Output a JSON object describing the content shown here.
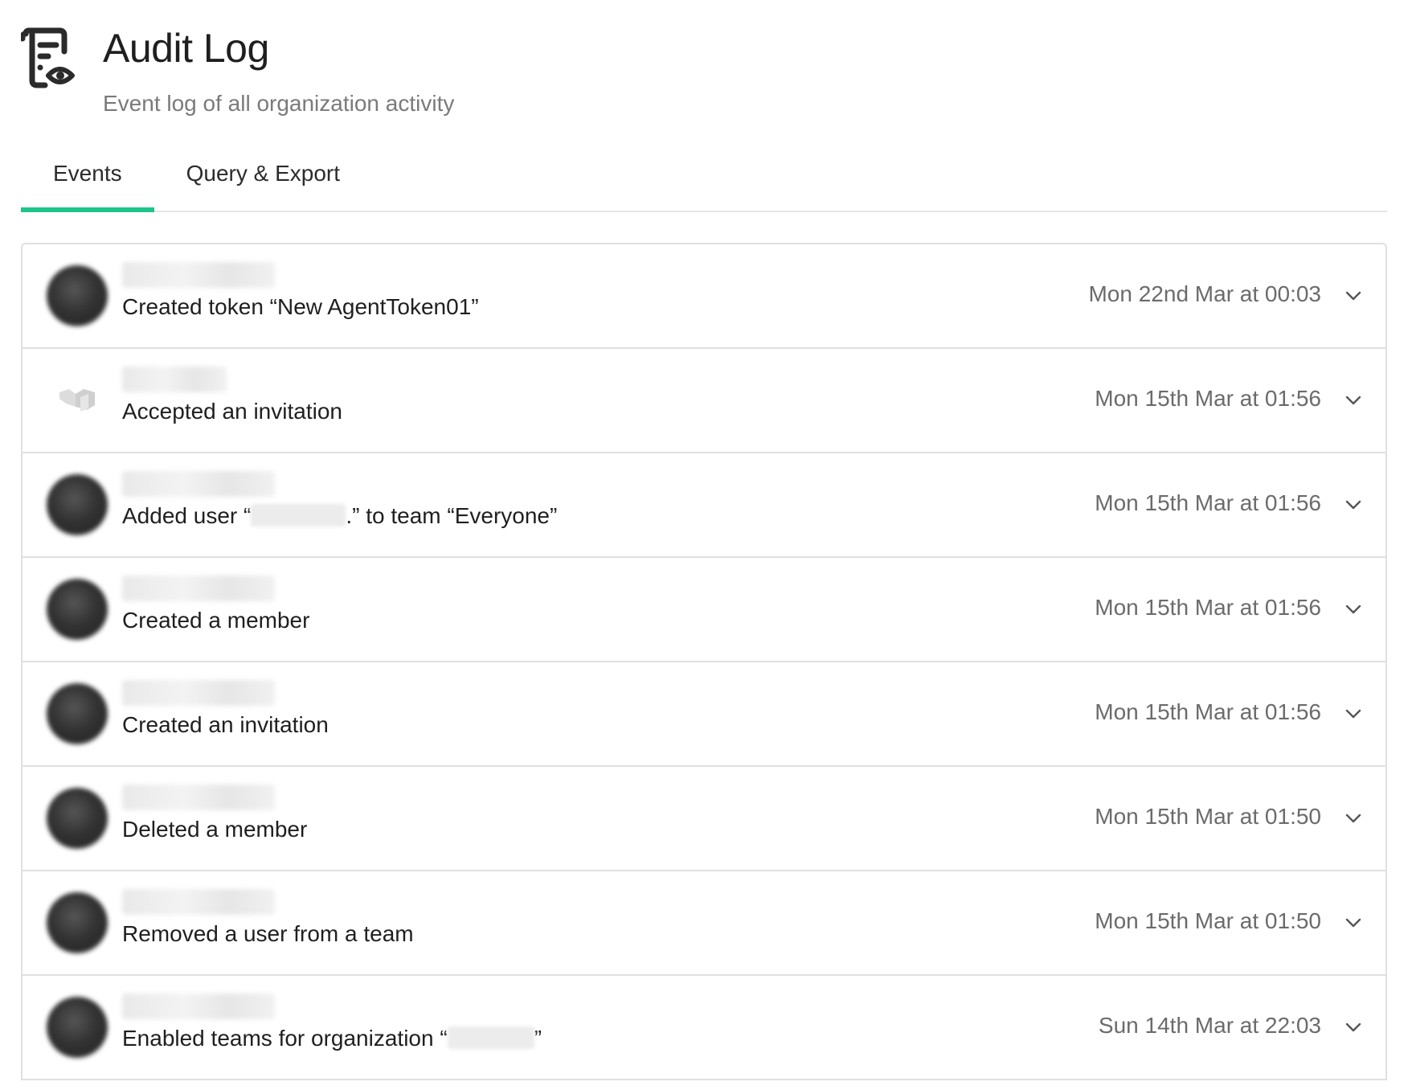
{
  "header": {
    "title": "Audit Log",
    "subtitle": "Event log of all organization activity",
    "icon": "audit-log-icon"
  },
  "tabs": [
    {
      "label": "Events",
      "active": true
    },
    {
      "label": "Query & Export",
      "active": false
    }
  ],
  "colors": {
    "accent": "#1fc48a",
    "border": "#e0e0e0",
    "muted_text": "#6b6b6b"
  },
  "events": [
    {
      "description": "Created token “New AgentToken01”",
      "timestamp": "Mon 22nd Mar at 00:03",
      "avatar": "user-avatar"
    },
    {
      "description": "Accepted an invitation",
      "timestamp": "Mon 15th Mar at 01:56",
      "avatar": "org-logo"
    },
    {
      "description_prefix": "Added user “",
      "description_suffix": ".” to team “Everyone”",
      "timestamp": "Mon 15th Mar at 01:56",
      "avatar": "user-avatar"
    },
    {
      "description": "Created a member",
      "timestamp": "Mon 15th Mar at 01:56",
      "avatar": "user-avatar"
    },
    {
      "description": "Created an invitation",
      "timestamp": "Mon 15th Mar at 01:56",
      "avatar": "user-avatar"
    },
    {
      "description": "Deleted a member",
      "timestamp": "Mon 15th Mar at 01:50",
      "avatar": "user-avatar"
    },
    {
      "description": "Removed a user from a team",
      "timestamp": "Mon 15th Mar at 01:50",
      "avatar": "user-avatar"
    },
    {
      "description_prefix": "Enabled teams for organization “",
      "description_suffix": "”",
      "timestamp": "Sun 14th Mar at 22:03",
      "avatar": "user-avatar"
    }
  ]
}
